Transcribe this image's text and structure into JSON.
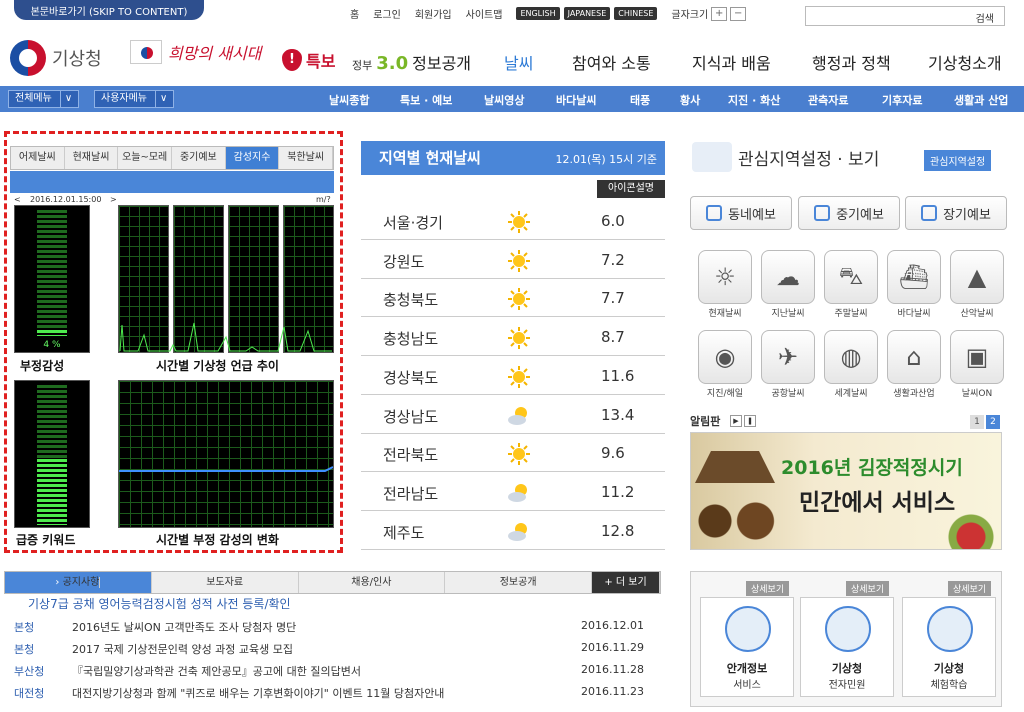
{
  "header": {
    "skip": "본문바로가기 (SKIP TO CONTENT)",
    "util": [
      "홈",
      "로그인",
      "회원가입",
      "사이트맵"
    ],
    "langs": [
      "ENGLISH",
      "JAPANESE",
      "CHINESE"
    ],
    "font_size_label": "글자크기",
    "font_plus": "+",
    "font_minus": "−",
    "search_button": "검색",
    "search_placeholder": ""
  },
  "brand": {
    "logo_text": "기상청",
    "slogan": "희망의 새시대",
    "alert_label": "특보",
    "gov_small": "정부",
    "gov_ver": "3.0",
    "gov_text": "정보공개"
  },
  "main_nav": [
    "날씨",
    "참여와 소통",
    "지식과 배움",
    "행정과 정책",
    "기상청소개"
  ],
  "sub_nav": {
    "all_menu": "전체메뉴",
    "user_menu": "사용자메뉴",
    "items": [
      "날씨종합",
      "특보 · 예보",
      "날씨영상",
      "바다날씨",
      "태풍",
      "황사",
      "지진 · 화산",
      "관측자료",
      "기후자료",
      "생활과 산업"
    ]
  },
  "left_panel": {
    "tabs": [
      "어제날씨",
      "현재날씨",
      "오늘~모레",
      "중기예보",
      "감성지수",
      "북한날씨"
    ],
    "active_tab": 4,
    "date": "2016.12.01.15:00",
    "unit": "m/?",
    "gauge_value": "4 %",
    "labels": {
      "neg": "부정감성",
      "trend": "시간별 기상청 언급 추이",
      "keyword": "급증 키워드",
      "change": "시간별 부정 감성의 변화"
    }
  },
  "weather": {
    "title": "지역별 현재날씨",
    "time": "12.01(목) 15시 기준",
    "legend": "아이콘설명",
    "rows": [
      {
        "region": "서울·경기",
        "icon": "sun",
        "temp": "6.0"
      },
      {
        "region": "강원도",
        "icon": "sun",
        "temp": "7.2"
      },
      {
        "region": "충청북도",
        "icon": "sun",
        "temp": "7.7"
      },
      {
        "region": "충청남도",
        "icon": "sun",
        "temp": "8.7"
      },
      {
        "region": "경상북도",
        "icon": "sun",
        "temp": "11.6"
      },
      {
        "region": "경상남도",
        "icon": "sun-cloud",
        "temp": "13.4"
      },
      {
        "region": "전라북도",
        "icon": "sun",
        "temp": "9.6"
      },
      {
        "region": "전라남도",
        "icon": "sun-cloud",
        "temp": "11.2"
      },
      {
        "region": "제주도",
        "icon": "sun-cloud",
        "temp": "12.8"
      }
    ]
  },
  "right": {
    "region_title": "관심지역설정 · 보기",
    "region_btn": "관심지역설정",
    "big_buttons": [
      "동네예보",
      "중기예보",
      "장기예보"
    ],
    "icons": [
      {
        "label": "현재날씨",
        "icon": "sun-icon",
        "glyph": "☼"
      },
      {
        "label": "지난날씨",
        "icon": "cloud-icon",
        "glyph": "☁"
      },
      {
        "label": "주말날씨",
        "icon": "car-icon",
        "glyph": "⛍"
      },
      {
        "label": "바다날씨",
        "icon": "ship-icon",
        "glyph": "⛴"
      },
      {
        "label": "산악날씨",
        "icon": "mountain-icon",
        "glyph": "▲"
      },
      {
        "label": "지진/해일",
        "icon": "antenna-icon",
        "glyph": "◉"
      },
      {
        "label": "공항날씨",
        "icon": "plane-icon",
        "glyph": "✈"
      },
      {
        "label": "세계날씨",
        "icon": "globe-icon",
        "glyph": "◍"
      },
      {
        "label": "생활과산업",
        "icon": "house-icon",
        "glyph": "⌂"
      },
      {
        "label": "날씨ON",
        "icon": "tv-icon",
        "glyph": "▣"
      }
    ],
    "notice_label": "알림판",
    "pages": [
      "1",
      "2"
    ],
    "banner_line1": "2016년 김장적정시기",
    "banner_line2": "민간에서 서비스"
  },
  "bottom": {
    "tabs": [
      "공지사항",
      "보도자료",
      "채용/인사",
      "정보공개"
    ],
    "more": "+ 더 보기",
    "headline": "기상7급 공채 영어능력검정시험 성적 사전 등록/확인",
    "news": [
      {
        "src": "본청",
        "title": "2016년도 날씨ON 고객만족도 조사 당첨자 명단",
        "date": "2016.12.01"
      },
      {
        "src": "본청",
        "title": "2017 국제 기상전문인력 양성 과정 교육생 모집",
        "date": "2016.11.29"
      },
      {
        "src": "부산청",
        "title": "『국립밀양기상과학관 건축 제안공모』공고에 대한 질의답변서",
        "date": "2016.11.28"
      },
      {
        "src": "대전청",
        "title": "대전지방기상청과 함께 \"퀴즈로 배우는 기후변화이야기\" 이벤트 11월 당첨자안내",
        "date": "2016.11.23"
      }
    ],
    "cards": [
      {
        "tag": "상세보기",
        "l1": "안개정보",
        "l2": "서비스"
      },
      {
        "tag": "상세보기",
        "l1": "기상청",
        "l2": "전자민원"
      },
      {
        "tag": "상세보기",
        "l1": "기상청",
        "l2": "체험학습"
      }
    ]
  }
}
